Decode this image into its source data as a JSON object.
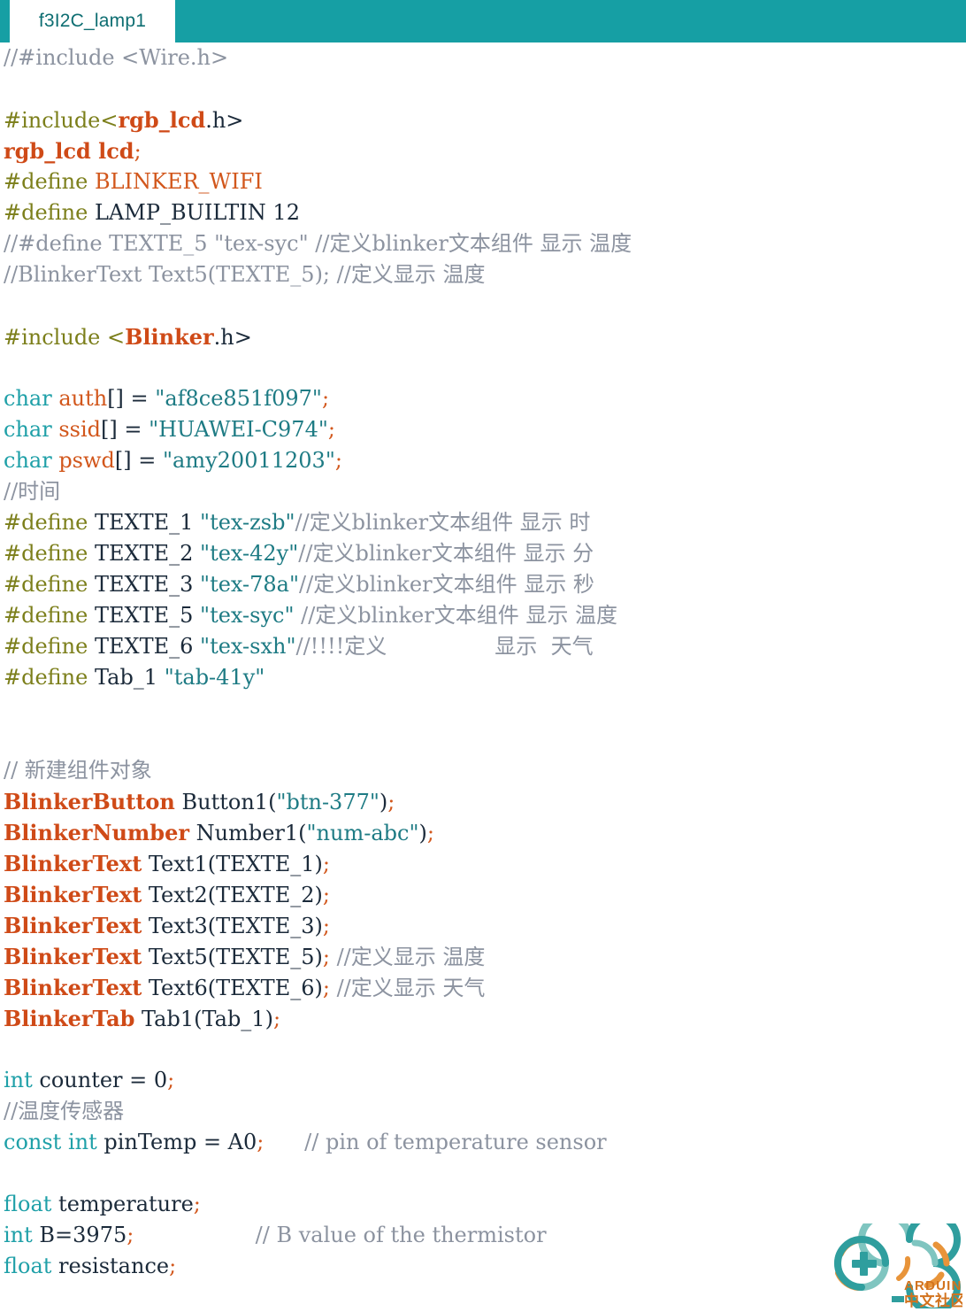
{
  "window": {
    "tab_label": "f3I2C_lamp1",
    "tab_bar_color": "#169fa4",
    "tab_text_color": "#0e6e72",
    "background": "#ffffff"
  },
  "theme": {
    "comment": "#8c93a0",
    "preprocessor": "#7c7f1b",
    "keyword": "#1fa0a8",
    "identifier": "#d2571c",
    "string": "#1e7b84",
    "punctuation": "#d2571c",
    "plain": "#1b2a3a",
    "class": "#cf4a17"
  },
  "logo": {
    "name": "arduino-chinese-community-logo",
    "wordmark": "ARDUINO",
    "subtitle": "中文社区",
    "colors": {
      "teal": "#2f9e9e",
      "orange": "#e8943a",
      "light_teal": "#7fc5c0",
      "text": "#d2731e"
    }
  },
  "code": {
    "lines": [
      [
        {
          "t": "cmt",
          "s": "//#include <Wire.h>"
        }
      ],
      [
        {
          "t": "plain",
          "s": ""
        }
      ],
      [
        {
          "t": "pre",
          "s": "#include<"
        },
        {
          "t": "cls",
          "s": "rgb_lcd"
        },
        {
          "t": "plain",
          "s": ".h>"
        }
      ],
      [
        {
          "t": "cls",
          "s": "rgb_lcd lcd"
        },
        {
          "t": "punc",
          "s": ";"
        }
      ],
      [
        {
          "t": "pre",
          "s": "#define "
        },
        {
          "t": "name",
          "s": "BLINKER_WIFI"
        }
      ],
      [
        {
          "t": "pre",
          "s": "#define "
        },
        {
          "t": "plain",
          "s": "LAMP_BUILTIN 12"
        }
      ],
      [
        {
          "t": "cmt",
          "s": "//#define TEXTE_5 \"tex-syc\" //定义blinker文本组件 显示 温度"
        }
      ],
      [
        {
          "t": "cmt",
          "s": "//BlinkerText Text5(TEXTE_5); //定义显示 温度"
        }
      ],
      [
        {
          "t": "plain",
          "s": ""
        }
      ],
      [
        {
          "t": "pre",
          "s": "#include <"
        },
        {
          "t": "cls",
          "s": "Blinker"
        },
        {
          "t": "plain",
          "s": ".h>"
        }
      ],
      [
        {
          "t": "plain",
          "s": ""
        }
      ],
      [
        {
          "t": "kw",
          "s": "char "
        },
        {
          "t": "name",
          "s": "auth"
        },
        {
          "t": "plain",
          "s": "[] = "
        },
        {
          "t": "str",
          "s": "\"af8ce851f097\""
        },
        {
          "t": "punc",
          "s": ";"
        }
      ],
      [
        {
          "t": "kw",
          "s": "char "
        },
        {
          "t": "name",
          "s": "ssid"
        },
        {
          "t": "plain",
          "s": "[] = "
        },
        {
          "t": "str",
          "s": "\"HUAWEI-C974\""
        },
        {
          "t": "punc",
          "s": ";"
        }
      ],
      [
        {
          "t": "kw",
          "s": "char "
        },
        {
          "t": "name",
          "s": "pswd"
        },
        {
          "t": "plain",
          "s": "[] = "
        },
        {
          "t": "str",
          "s": "\"amy20011203\""
        },
        {
          "t": "punc",
          "s": ";"
        }
      ],
      [
        {
          "t": "cmt",
          "s": "//时间"
        }
      ],
      [
        {
          "t": "pre",
          "s": "#define "
        },
        {
          "t": "plain",
          "s": "TEXTE_1 "
        },
        {
          "t": "str",
          "s": "\"tex-zsb\""
        },
        {
          "t": "cmt",
          "s": "//定义blinker文本组件 显示 时"
        }
      ],
      [
        {
          "t": "pre",
          "s": "#define "
        },
        {
          "t": "plain",
          "s": "TEXTE_2 "
        },
        {
          "t": "str",
          "s": "\"tex-42y\""
        },
        {
          "t": "cmt",
          "s": "//定义blinker文本组件 显示 分"
        }
      ],
      [
        {
          "t": "pre",
          "s": "#define "
        },
        {
          "t": "plain",
          "s": "TEXTE_3 "
        },
        {
          "t": "str",
          "s": "\"tex-78a\""
        },
        {
          "t": "cmt",
          "s": "//定义blinker文本组件 显示 秒"
        }
      ],
      [
        {
          "t": "pre",
          "s": "#define "
        },
        {
          "t": "plain",
          "s": "TEXTE_5 "
        },
        {
          "t": "str",
          "s": "\"tex-syc\""
        },
        {
          "t": "cmt",
          "s": " //定义blinker文本组件 显示 温度"
        }
      ],
      [
        {
          "t": "pre",
          "s": "#define "
        },
        {
          "t": "plain",
          "s": "TEXTE_6 "
        },
        {
          "t": "str",
          "s": "\"tex-sxh\""
        },
        {
          "t": "cmt",
          "s": "//!!!!定义                显示  天气"
        }
      ],
      [
        {
          "t": "pre",
          "s": "#define "
        },
        {
          "t": "plain",
          "s": "Tab_1 "
        },
        {
          "t": "str",
          "s": "\"tab-41y\""
        }
      ],
      [
        {
          "t": "plain",
          "s": ""
        }
      ],
      [
        {
          "t": "plain",
          "s": ""
        }
      ],
      [
        {
          "t": "cmt",
          "s": "// 新建组件对象"
        }
      ],
      [
        {
          "t": "cls",
          "s": "BlinkerButton"
        },
        {
          "t": "plain",
          "s": " Button1("
        },
        {
          "t": "str",
          "s": "\"btn-377\""
        },
        {
          "t": "plain",
          "s": ")"
        },
        {
          "t": "punc",
          "s": ";"
        }
      ],
      [
        {
          "t": "cls",
          "s": "BlinkerNumber"
        },
        {
          "t": "plain",
          "s": " Number1("
        },
        {
          "t": "str",
          "s": "\"num-abc\""
        },
        {
          "t": "plain",
          "s": ")"
        },
        {
          "t": "punc",
          "s": ";"
        }
      ],
      [
        {
          "t": "cls",
          "s": "BlinkerText"
        },
        {
          "t": "plain",
          "s": " Text1(TEXTE_1)"
        },
        {
          "t": "punc",
          "s": ";"
        }
      ],
      [
        {
          "t": "cls",
          "s": "BlinkerText"
        },
        {
          "t": "plain",
          "s": " Text2(TEXTE_2)"
        },
        {
          "t": "punc",
          "s": ";"
        }
      ],
      [
        {
          "t": "cls",
          "s": "BlinkerText"
        },
        {
          "t": "plain",
          "s": " Text3(TEXTE_3)"
        },
        {
          "t": "punc",
          "s": ";"
        }
      ],
      [
        {
          "t": "cls",
          "s": "BlinkerText"
        },
        {
          "t": "plain",
          "s": " Text5(TEXTE_5)"
        },
        {
          "t": "punc",
          "s": ";"
        },
        {
          "t": "cmt",
          "s": " //定义显示 温度"
        }
      ],
      [
        {
          "t": "cls",
          "s": "BlinkerText"
        },
        {
          "t": "plain",
          "s": " Text6(TEXTE_6)"
        },
        {
          "t": "punc",
          "s": ";"
        },
        {
          "t": "cmt",
          "s": " //定义显示 天气"
        }
      ],
      [
        {
          "t": "cls",
          "s": "BlinkerTab"
        },
        {
          "t": "plain",
          "s": " Tab1(Tab_1)"
        },
        {
          "t": "punc",
          "s": ";"
        }
      ],
      [
        {
          "t": "plain",
          "s": ""
        }
      ],
      [
        {
          "t": "kw",
          "s": "int "
        },
        {
          "t": "plain",
          "s": "counter = 0"
        },
        {
          "t": "punc",
          "s": ";"
        }
      ],
      [
        {
          "t": "cmt",
          "s": "//温度传感器"
        }
      ],
      [
        {
          "t": "kw",
          "s": "const int "
        },
        {
          "t": "plain",
          "s": "pinTemp = A0"
        },
        {
          "t": "punc",
          "s": ";"
        },
        {
          "t": "cmt",
          "s": "      // pin of temperature sensor"
        }
      ],
      [
        {
          "t": "plain",
          "s": ""
        }
      ],
      [
        {
          "t": "kw",
          "s": "float "
        },
        {
          "t": "plain",
          "s": "temperature"
        },
        {
          "t": "punc",
          "s": ";"
        }
      ],
      [
        {
          "t": "kw",
          "s": "int "
        },
        {
          "t": "plain",
          "s": "B=3975"
        },
        {
          "t": "punc",
          "s": ";"
        },
        {
          "t": "cmt",
          "s": "                  // B value of the thermistor"
        }
      ],
      [
        {
          "t": "kw",
          "s": "float "
        },
        {
          "t": "plain",
          "s": "resistance"
        },
        {
          "t": "punc",
          "s": ";"
        }
      ]
    ]
  }
}
